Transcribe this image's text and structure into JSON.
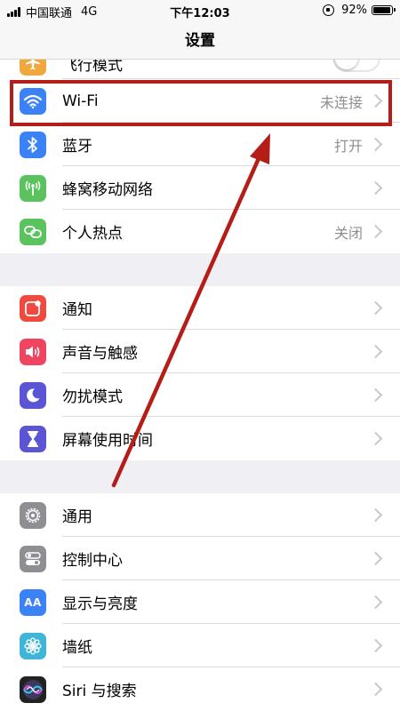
{
  "status_bar": {
    "carrier": "中国联通",
    "network": "4G",
    "time": "下午12:03",
    "battery": "92%"
  },
  "nav": {
    "title": "设置"
  },
  "groups": [
    {
      "items": [
        {
          "label": "飞行模式",
          "icon": "airplane-icon",
          "color": "#f0a73c",
          "control": "toggle",
          "on": false
        },
        {
          "label": "Wi-Fi",
          "icon": "wifi-icon",
          "color": "#3b82f6",
          "value": "未连接"
        },
        {
          "label": "蓝牙",
          "icon": "bluetooth-icon",
          "color": "#3b82f6",
          "value": "打开"
        },
        {
          "label": "蜂窝移动网络",
          "icon": "cellular-antenna-icon",
          "color": "#5ac35e",
          "value": ""
        },
        {
          "label": "个人热点",
          "icon": "personal-hotspot-icon",
          "color": "#5ac35e",
          "value": "关闭"
        }
      ]
    },
    {
      "items": [
        {
          "label": "通知",
          "icon": "notification-icon",
          "color": "#ef4a3f"
        },
        {
          "label": "声音与触感",
          "icon": "speaker-icon",
          "color": "#ef4560"
        },
        {
          "label": "勿扰模式",
          "icon": "moon-icon",
          "color": "#5b55d6"
        },
        {
          "label": "屏幕使用时间",
          "icon": "hourglass-icon",
          "color": "#5b55d6"
        }
      ]
    },
    {
      "items": [
        {
          "label": "通用",
          "icon": "gear-icon",
          "color": "#8e8e93"
        },
        {
          "label": "控制中心",
          "icon": "control-center-icon",
          "color": "#8e8e93"
        },
        {
          "label": "显示与亮度",
          "icon": "display-aa-icon",
          "color": "#3b82f6",
          "icon_text": "AA"
        },
        {
          "label": "墙纸",
          "icon": "wallpaper-flower-icon",
          "color": "#3fb6d8"
        },
        {
          "label": "Siri 与搜索",
          "icon": "siri-icon",
          "color": "#222222"
        }
      ]
    }
  ],
  "annotation": {
    "highlight_color": "#b51d18",
    "highlighted_item": "Wi-Fi"
  }
}
